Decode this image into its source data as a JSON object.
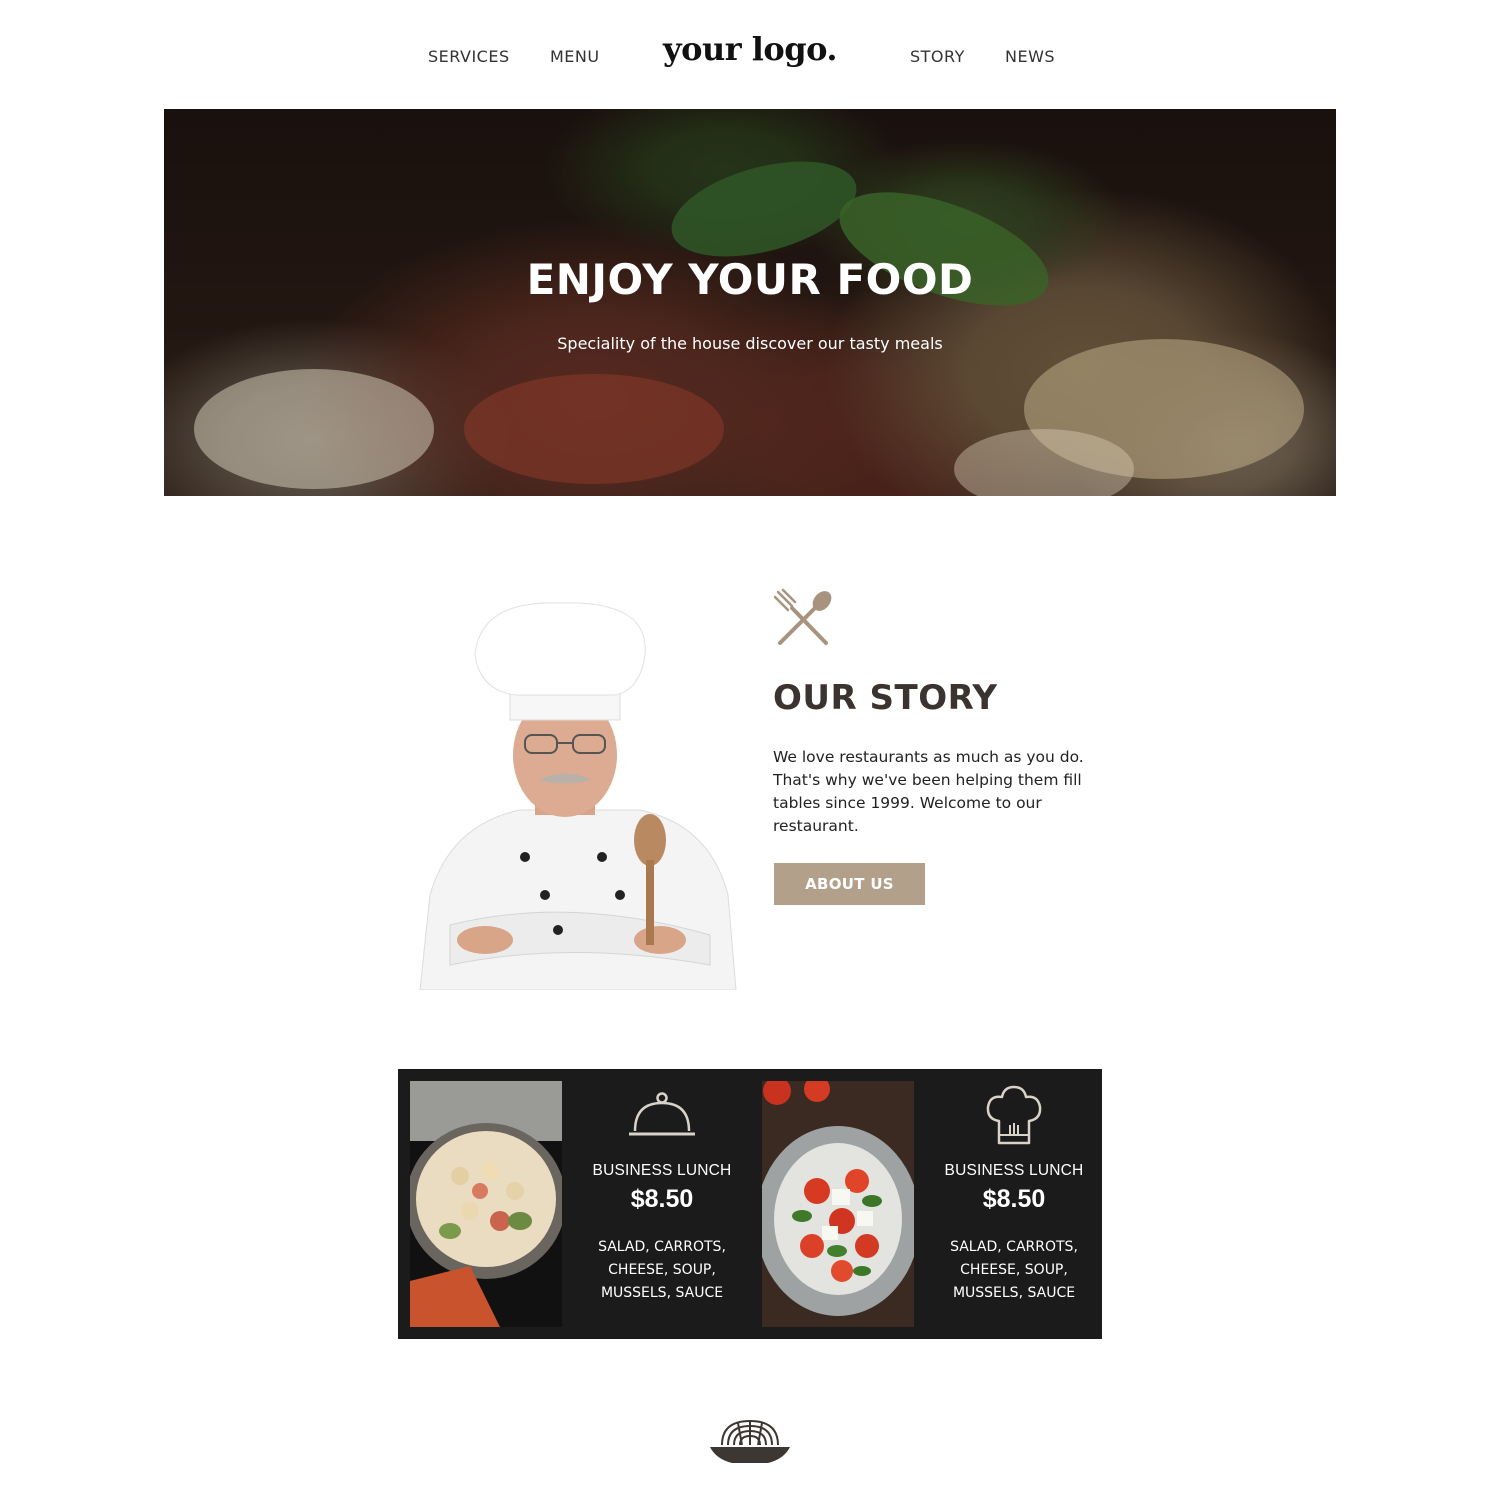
{
  "nav": {
    "left_links": [
      "SERVICES",
      "MENU"
    ],
    "logo": "your logo.",
    "right_links": [
      "STORY",
      "NEWS"
    ]
  },
  "hero": {
    "title": "ENJOY YOUR FOOD",
    "subtitle": "Speciality of the house discover our tasty meals"
  },
  "story": {
    "icon": "fork-spoon-icon",
    "title": "OUR STORY",
    "text": "We love restaurants as much as you do. That's why we've been helping them fill tables since 1999. Welcome to our restaurant.",
    "button": "ABOUT US",
    "accent": "#b3a08a"
  },
  "menu_cards": [
    {
      "icon": "cloche-icon",
      "title": "BUSINESS LUNCH",
      "price": "$8.50",
      "description": "SALAD, CARROTS, CHEESE, SOUP, MUSSELS, SAUCE"
    },
    {
      "icon": "chef-hat-icon",
      "title": "BUSINESS LUNCH",
      "price": "$8.50",
      "description": "SALAD, CARROTS, CHEESE, SOUP, MUSSELS, SAUCE"
    }
  ],
  "footer": {
    "icon": "noodle-bowl-icon"
  },
  "colors": {
    "dark_panel": "#1b1b1b",
    "heading": "#3a3330"
  }
}
